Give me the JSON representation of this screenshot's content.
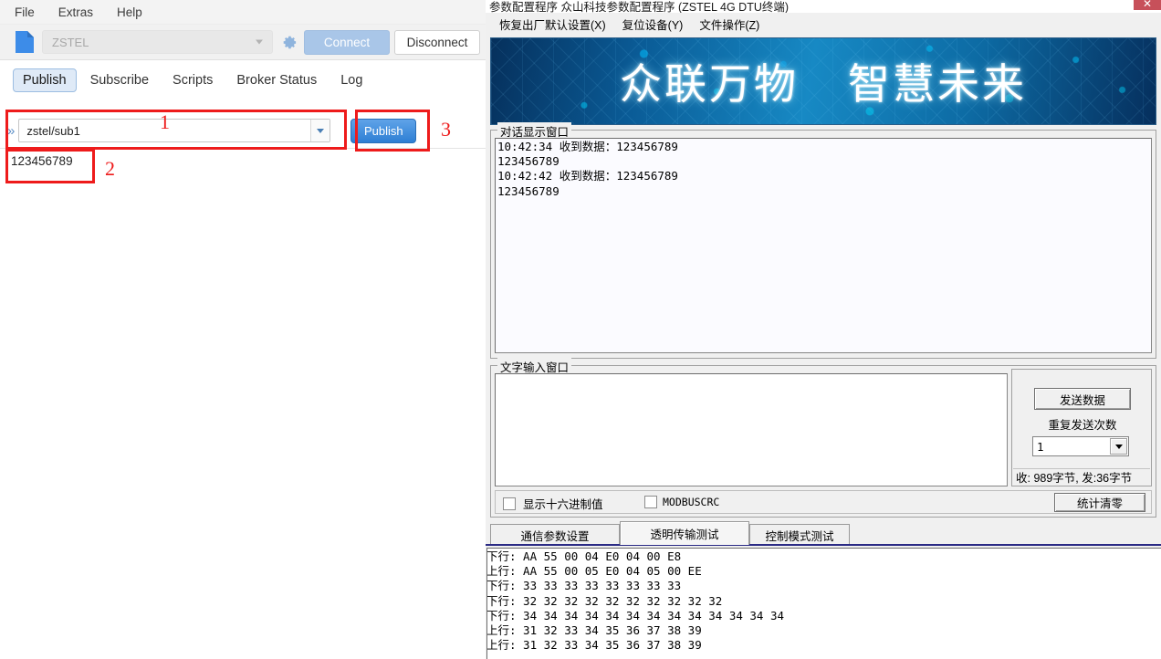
{
  "mqtt_client": {
    "menu": [
      {
        "label": "File"
      },
      {
        "label": "Extras"
      },
      {
        "label": "Help"
      }
    ],
    "toolbar": {
      "doc_icon": "new-document-icon",
      "broker_value": "ZSTEL",
      "gear_icon": "gear-icon",
      "connect_label": "Connect",
      "disconnect_label": "Disconnect"
    },
    "tabs": [
      {
        "label": "Publish",
        "active": true
      },
      {
        "label": "Subscribe",
        "active": false
      },
      {
        "label": "Scripts",
        "active": false
      },
      {
        "label": "Broker Status",
        "active": false
      },
      {
        "label": "Log",
        "active": false
      }
    ],
    "publish": {
      "expander_icon": "chevron-double-right-icon",
      "topic_value": "zstel/sub1",
      "topic_dropdown_icon": "chevron-down-icon",
      "publish_button": "Publish",
      "payload_value": "123456789"
    },
    "annotations": [
      {
        "number": "1"
      },
      {
        "number": "2"
      },
      {
        "number": "3"
      }
    ],
    "annotation_color": "#ee1b1b"
  },
  "config_tool": {
    "window_title": "参数配置程序 众山科技参数配置程序 (ZSTEL 4G DTU终端)",
    "close_icon": "close-icon",
    "menu": [
      {
        "label": "恢复出厂默认设置(X)"
      },
      {
        "label": "复位设备(Y)"
      },
      {
        "label": "文件操作(Z)"
      }
    ],
    "banner": {
      "left_text": "众联万物",
      "right_text": "智慧未来"
    },
    "dialog_window": {
      "title": "对话显示窗口",
      "lines": [
        "10:42:34 收到数据：123456789",
        "123456789",
        "10:42:42 收到数据：123456789",
        "123456789"
      ]
    },
    "text_input_window": {
      "title": "文字输入窗口",
      "value": ""
    },
    "send_panel": {
      "send_button": "发送数据",
      "repeat_label": "重复发送次数",
      "repeat_value": "1",
      "stats_text": "收: 989字节, 发:36字节"
    },
    "options_bar": {
      "hex_checkbox_label": "显示十六进制值",
      "hex_checked": false,
      "modbus_checkbox_label": "MODBUSCRC",
      "modbus_checked": false,
      "clear_button": "统计清零"
    },
    "tabs": [
      {
        "label": "通信参数设置",
        "active": false
      },
      {
        "label": "透明传输测试",
        "active": true
      },
      {
        "label": "控制模式测试",
        "active": false
      }
    ],
    "packet_log": {
      "lines": [
        "下行: AA 55 00 04 E0 04 00 E8",
        "上行: AA 55 00 05 E0 04 05 00 EE",
        "下行: 33 33 33 33 33 33 33 33",
        "下行: 32 32 32 32 32 32 32 32 32 32",
        "下行: 34 34 34 34 34 34 34 34 34 34 34 34 34",
        "上行: 31 32 33 34 35 36 37 38 39",
        "上行: 31 32 33 34 35 36 37 38 39"
      ]
    }
  }
}
